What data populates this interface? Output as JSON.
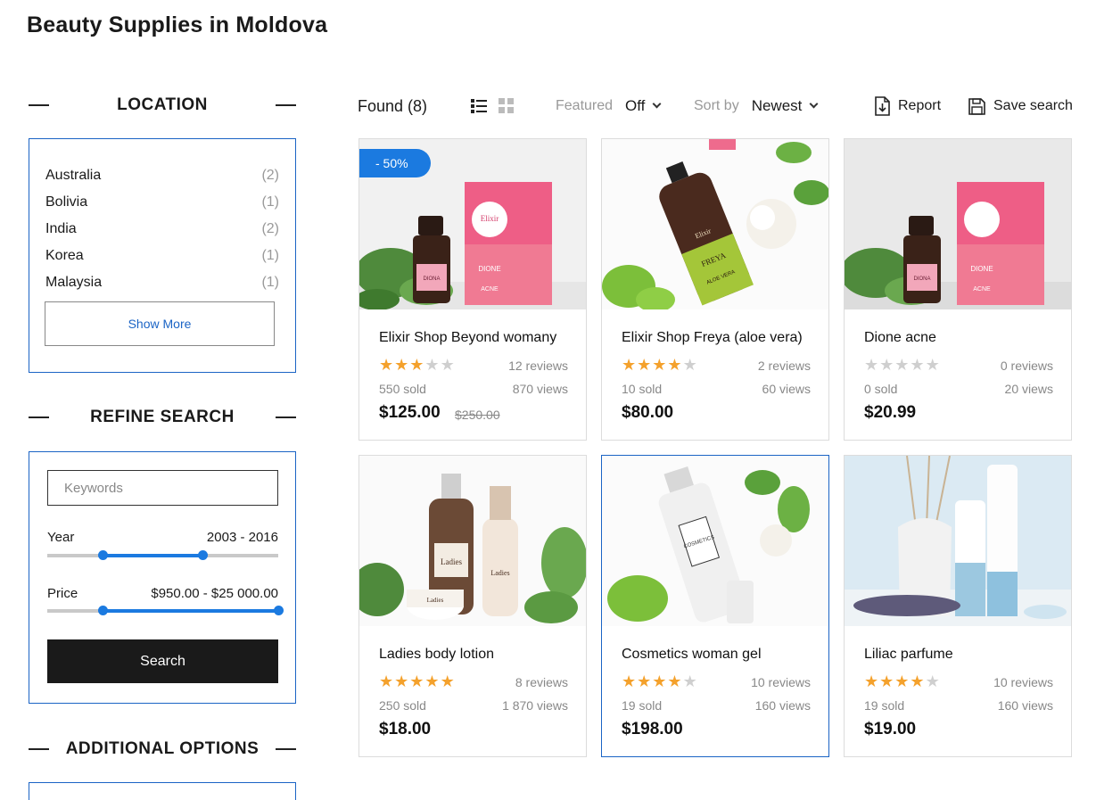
{
  "page": {
    "title": "Beauty Supplies in Moldova"
  },
  "sidebar": {
    "location": {
      "heading": "LOCATION",
      "items": [
        {
          "label": "Australia",
          "count": "(2)"
        },
        {
          "label": "Bolivia",
          "count": "(1)"
        },
        {
          "label": "India",
          "count": "(2)"
        },
        {
          "label": "Korea",
          "count": "(1)"
        },
        {
          "label": "Malaysia",
          "count": "(1)"
        }
      ],
      "show_more": "Show More"
    },
    "refine": {
      "heading": "REFINE SEARCH",
      "keywords_placeholder": "Keywords",
      "year_label": "Year",
      "year_value": "2003 - 2016",
      "year_range_fraction": [
        0.24,
        0.67
      ],
      "price_label": "Price",
      "price_value": "$950.00 - $25 000.00",
      "price_range_fraction": [
        0.24,
        1.0
      ],
      "search_label": "Search"
    },
    "additional": {
      "heading": "ADDITIONAL OPTIONS"
    }
  },
  "toolbar": {
    "found": "Found (8)",
    "featured_label": "Featured",
    "featured_value": "Off",
    "sort_label": "Sort by",
    "sort_value": "Newest",
    "report": "Report",
    "save_search": "Save search",
    "active_view": "list"
  },
  "products": [
    {
      "name": "Elixir Shop Beyond womany",
      "rating": 3,
      "reviews": "12 reviews",
      "sold": "550 sold",
      "views": "870 views",
      "price": "$125.00",
      "old_price": "$250.00",
      "badge": "- 50%"
    },
    {
      "name": "Elixir Shop Freya (aloe vera)",
      "rating": 4,
      "reviews": "2 reviews",
      "sold": "10 sold",
      "views": "60 views",
      "price": "$80.00"
    },
    {
      "name": "Dione acne",
      "rating": 0,
      "reviews": "0 reviews",
      "sold": "0 sold",
      "views": "20 views",
      "price": "$20.99"
    },
    {
      "name": "Ladies body lotion",
      "rating": 5,
      "reviews": "8 reviews",
      "sold": "250 sold",
      "views": "1 870 views",
      "price": "$18.00"
    },
    {
      "name": "Cosmetics woman gel",
      "rating": 4,
      "reviews": "10 reviews",
      "sold": "19 sold",
      "views": "160 views",
      "price": "$198.00"
    },
    {
      "name": "Liliac parfume",
      "rating": 4,
      "reviews": "10 reviews",
      "sold": "19 sold",
      "views": "160 views",
      "price": "$19.00"
    }
  ],
  "product_image_labels": {
    "p1": [
      "DIONE",
      "Elixir",
      "ACNE",
      "DIONA"
    ],
    "p2": [
      "FREYA",
      "ALOE VERA",
      "Elixir"
    ],
    "p3": [
      "DIONE",
      "ACNE",
      "DIONA"
    ],
    "p4": [
      "Ladies",
      "Ladies",
      "Ladies"
    ],
    "p5": [
      "COSMETICS"
    ]
  },
  "colors": {
    "accent": "#1b7ae0",
    "border_accent": "#1b64c5",
    "star": "#f4a12c"
  }
}
